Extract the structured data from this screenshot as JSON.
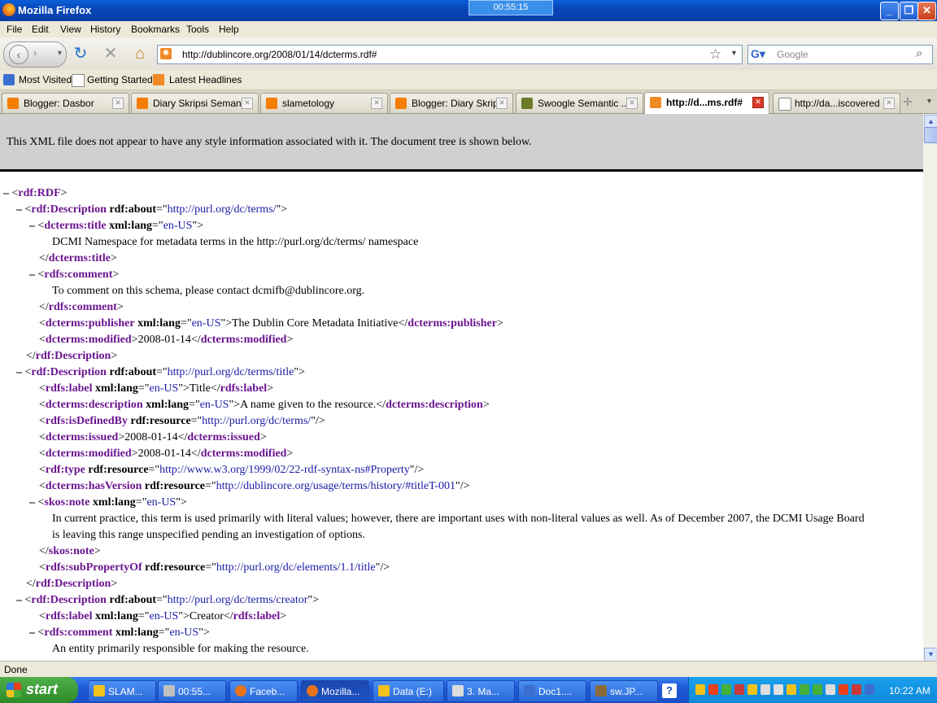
{
  "window": {
    "title": "Mozilla Firefox",
    "timer": "00:55:15"
  },
  "menu": [
    "File",
    "Edit",
    "View",
    "History",
    "Bookmarks",
    "Tools",
    "Help"
  ],
  "nav": {
    "url": "http://dublincore.org/2008/01/14/dcterms.rdf#",
    "search_placeholder": "Google"
  },
  "bookmarks": [
    "Most Visited",
    "Getting Started",
    "Latest Headlines"
  ],
  "tabs": [
    {
      "label": "Blogger: Dasbor",
      "icon_color": "#f57d00"
    },
    {
      "label": "Diary Skripsi Seman...",
      "icon_color": "#f57d00"
    },
    {
      "label": "slametology",
      "icon_color": "#f57d00"
    },
    {
      "label": "Blogger: Diary Skrip...",
      "icon_color": "#f57d00"
    },
    {
      "label": "Swoogle Semantic ...",
      "icon_color": "#6a7a2a"
    },
    {
      "label": "http://d...ms.rdf#",
      "icon_color": "#f08a24"
    },
    {
      "label": "http://da...iscovered",
      "icon_color": "#ffffff"
    }
  ],
  "xml": {
    "header": "This XML file does not appear to have any style information associated with it. The document tree is shown below.",
    "text_en": "DCMI Namespace for metadata terms in the http://purl.org/dc/terms/ namespace",
    "text_comment": "To comment on this schema, please contact dcmifb@dublincore.org.",
    "publisher": "The Dublin Core Metadata Initiative",
    "date": "2008-01-14",
    "about1": "http://purl.org/dc/terms/",
    "about2": "http://purl.org/dc/terms/title",
    "about3": "http://purl.org/dc/terms/creator",
    "lang": "en-US",
    "label_title": "Title",
    "desc_title": "A name given to the resource.",
    "defined_by": "http://purl.org/dc/terms/",
    "type_res": "http://www.w3.org/1999/02/22-rdf-syntax-ns#Property",
    "version_res": "http://dublincore.org/usage/terms/history/#titleT-001",
    "note_line1": "In current practice, this term is used primarily with literal values; however, there are important uses with non-literal values as well. As of December 2007, the DCMI Usage Board",
    "note_line2": "is leaving this range unspecified pending an investigation of options.",
    "subprop": "http://purl.org/dc/elements/1.1/title",
    "label_creator": "Creator",
    "comment_creator": "An entity primarily responsible for making the resource."
  },
  "status": "Done",
  "taskbar": {
    "start": "start",
    "items": [
      {
        "label": "SLAM...",
        "icon_color": "#f2c21c"
      },
      {
        "label": "00:55...",
        "icon_color": "#c0c0c0"
      },
      {
        "label": "Faceb...",
        "icon_color": "#e8731a"
      },
      {
        "label": "Mozilla...",
        "icon_color": "#e8731a"
      },
      {
        "label": "Data (E:)",
        "icon_color": "#f2c21c"
      },
      {
        "label": "3. Ma...",
        "icon_color": "#dcdcdc"
      },
      {
        "label": "Doc1....",
        "icon_color": "#3a6fd0"
      },
      {
        "label": "sw.JP...",
        "icon_color": "#8a6a3a"
      }
    ],
    "help": "?",
    "time": "10:22 AM"
  }
}
